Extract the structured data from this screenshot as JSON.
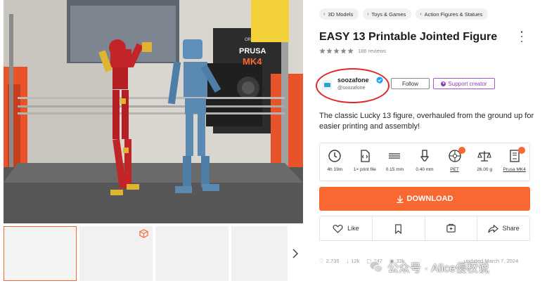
{
  "breadcrumbs": [
    "3D Models",
    "Toys & Games",
    "Action Figures & Statues"
  ],
  "title": "EASY 13 Printable Jointed Figure",
  "rating": {
    "stars": 5,
    "reviews": "186 reviews"
  },
  "creator": {
    "name": "soozafone",
    "handle": "@soozafone",
    "follow_label": "Follow",
    "support_label": "Support creator"
  },
  "description": "The classic Lucky 13 figure, overhauled from the ground up for easier printing and assembly!",
  "specs": [
    {
      "icon": "clock-icon",
      "value": "4h 19m",
      "link": false,
      "badge": false
    },
    {
      "icon": "file-code-icon",
      "value": "1× print file",
      "link": false,
      "badge": false
    },
    {
      "icon": "layer-height-icon",
      "value": "0.15 mm",
      "link": false,
      "badge": false
    },
    {
      "icon": "nozzle-icon",
      "value": "0.40 mm",
      "link": false,
      "badge": false
    },
    {
      "icon": "filament-spool-icon",
      "value": "PET",
      "link": true,
      "badge": true
    },
    {
      "icon": "scale-icon",
      "value": "26.00 g",
      "link": false,
      "badge": false
    },
    {
      "icon": "printer-icon",
      "value": "Prusa MK4",
      "link": true,
      "badge": true
    }
  ],
  "download_label": "DOWNLOAD",
  "actions": {
    "like": "Like",
    "bookmark": "",
    "collection": "",
    "share": "Share"
  },
  "stats": {
    "likes": "2,735",
    "downloads": "12k",
    "comments": "247",
    "views": "33k"
  },
  "updated": "updated March 7, 2024",
  "watermark": "公众号 · Alice侵权说",
  "photo_printer_labels": {
    "brand": "PRUSA",
    "model": "MK4",
    "small": "ORIGINAL"
  },
  "colors": {
    "accent": "#fa6831",
    "support": "#9240b8",
    "verified": "#1da1f2",
    "highlight": "#e3262a"
  }
}
